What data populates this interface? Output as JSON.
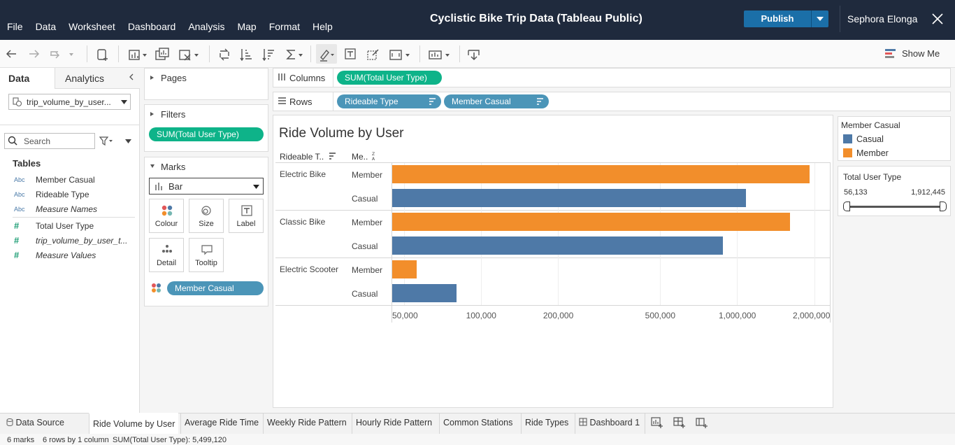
{
  "window": {
    "title": "Cyclistic Bike Trip Data (Tableau Public)",
    "menu": [
      "File",
      "Data",
      "Worksheet",
      "Dashboard",
      "Analysis",
      "Map",
      "Format",
      "Help"
    ],
    "publish_label": "Publish",
    "user": "Sephora Elonga"
  },
  "toolbar": {
    "show_me_label": "Show Me"
  },
  "data_pane": {
    "tab_data": "Data",
    "tab_analytics": "Analytics",
    "datasource": "trip_volume_by_user...",
    "search_placeholder": "Search",
    "tables_heading": "Tables",
    "fields": [
      {
        "type": "Abc",
        "name": "Member Casual"
      },
      {
        "type": "Abc",
        "name": "Rideable Type"
      },
      {
        "type": "Abc",
        "name": "Measure Names"
      },
      {
        "type": "#",
        "name": "Total User Type"
      },
      {
        "type": "#",
        "name": "trip_volume_by_user_t..."
      },
      {
        "type": "#",
        "name": "Measure Values"
      }
    ]
  },
  "shelves": {
    "pages_label": "Pages",
    "filters_label": "Filters",
    "filter_pill": "SUM(Total User Type)",
    "marks_label": "Marks",
    "mark_type": "Bar",
    "mark_buttons": [
      "Colour",
      "Size",
      "Label",
      "Detail",
      "Tooltip"
    ],
    "color_pill": "Member Casual",
    "columns_label": "Columns",
    "columns_pill": "SUM(Total User Type)",
    "rows_label": "Rows",
    "rows_pills": [
      "Rideable Type",
      "Member Casual"
    ]
  },
  "view": {
    "title": "Ride Volume by User",
    "header_rideable": "Rideable T..",
    "header_member": "Me..",
    "groups": [
      "Electric Bike",
      "Classic Bike",
      "Electric Scooter"
    ],
    "subrows": [
      "Member",
      "Casual",
      "Member",
      "Casual",
      "Member",
      "Casual"
    ]
  },
  "chart_data": {
    "type": "bar",
    "orientation": "horizontal",
    "x_scale": "log",
    "xlim": [
      45000,
      2300000
    ],
    "x_ticks": [
      50000,
      100000,
      200000,
      500000,
      1000000,
      2000000
    ],
    "x_tick_labels": [
      "50,000",
      "100,000",
      "200,000",
      "500,000",
      "1,000,000",
      "2,000,000"
    ],
    "categories": [
      "Electric Bike / Member",
      "Electric Bike / Casual",
      "Classic Bike / Member",
      "Classic Bike / Casual",
      "Electric Scooter / Member",
      "Electric Scooter / Casual"
    ],
    "values": [
      1912445,
      1085000,
      1610000,
      880000,
      56133,
      80000
    ],
    "colors": [
      "#f28e2b",
      "#4e79a7",
      "#f28e2b",
      "#4e79a7",
      "#f28e2b",
      "#4e79a7"
    ]
  },
  "legend": {
    "title": "Member Casual",
    "items": [
      {
        "label": "Casual",
        "color": "#4e79a7"
      },
      {
        "label": "Member",
        "color": "#f28e2b"
      }
    ]
  },
  "filter_card": {
    "title": "Total User Type",
    "min": "56,133",
    "max": "1,912,445"
  },
  "sheet_tabs": {
    "data_source": "Data Source",
    "sheets": [
      "Ride Volume by User",
      "Average Ride Time",
      "Weekly Ride Pattern",
      "Hourly Ride Pattern",
      "Common Stations",
      "Ride Types"
    ],
    "dashboard": "Dashboard 1"
  },
  "status": {
    "marks": "6 marks",
    "rows_cols": "6 rows by 1 column",
    "sum": "SUM(Total User Type): 5,499,120"
  }
}
